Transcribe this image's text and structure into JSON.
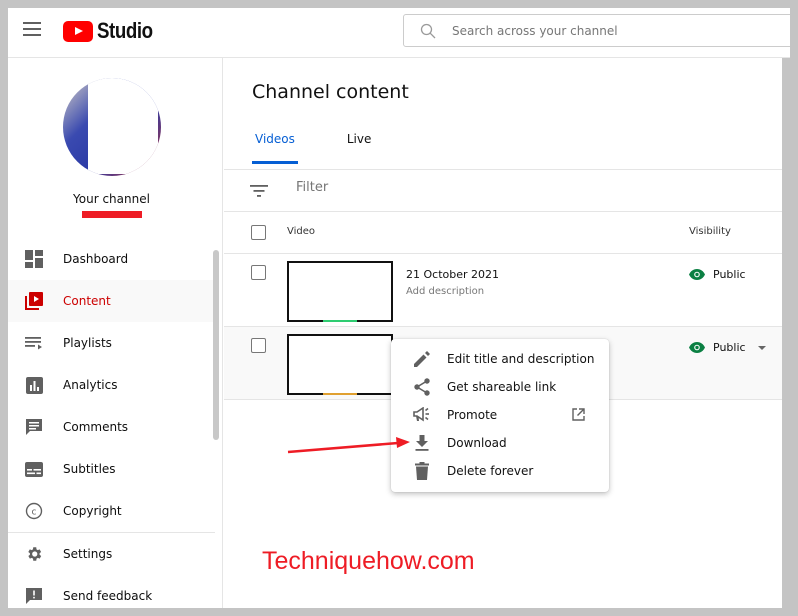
{
  "header": {
    "app_name": "Studio",
    "search_placeholder": "Search across your channel"
  },
  "sidebar": {
    "channel_label": "Your channel",
    "items": [
      {
        "label": "Dashboard",
        "icon": "dashboard-icon",
        "active": false
      },
      {
        "label": "Content",
        "icon": "content-icon",
        "active": true
      },
      {
        "label": "Playlists",
        "icon": "playlists-icon",
        "active": false
      },
      {
        "label": "Analytics",
        "icon": "analytics-icon",
        "active": false
      },
      {
        "label": "Comments",
        "icon": "comments-icon",
        "active": false
      },
      {
        "label": "Subtitles",
        "icon": "subtitles-icon",
        "active": false
      },
      {
        "label": "Copyright",
        "icon": "copyright-icon",
        "active": false
      }
    ],
    "footer_items": [
      {
        "label": "Settings",
        "icon": "gear-icon"
      },
      {
        "label": "Send feedback",
        "icon": "feedback-icon"
      }
    ]
  },
  "main": {
    "title": "Channel content",
    "tabs": [
      {
        "label": "Videos",
        "active": true
      },
      {
        "label": "Live",
        "active": false
      }
    ],
    "filter_placeholder": "Filter",
    "columns": {
      "video": "Video",
      "visibility": "Visibility"
    },
    "rows": [
      {
        "date": "21 October 2021",
        "description": "Add description",
        "visibility": "Public"
      },
      {
        "date": "",
        "description": "",
        "visibility": "Public"
      }
    ]
  },
  "context_menu": {
    "items": [
      {
        "label": "Edit title and description",
        "icon": "pencil-icon"
      },
      {
        "label": "Get shareable link",
        "icon": "share-icon"
      },
      {
        "label": "Promote",
        "icon": "megaphone-icon",
        "external": true
      },
      {
        "label": "Download",
        "icon": "download-icon"
      },
      {
        "label": "Delete forever",
        "icon": "trash-icon"
      }
    ]
  },
  "annotation": {
    "watermark": "Techniquehow.com",
    "arrow_target": "Download"
  },
  "colors": {
    "accent_blue": "#065fd4",
    "brand_red": "#ff0000",
    "active_red": "#cc0000",
    "public_green": "#0b8043",
    "annotation_red": "#ee1c25"
  }
}
